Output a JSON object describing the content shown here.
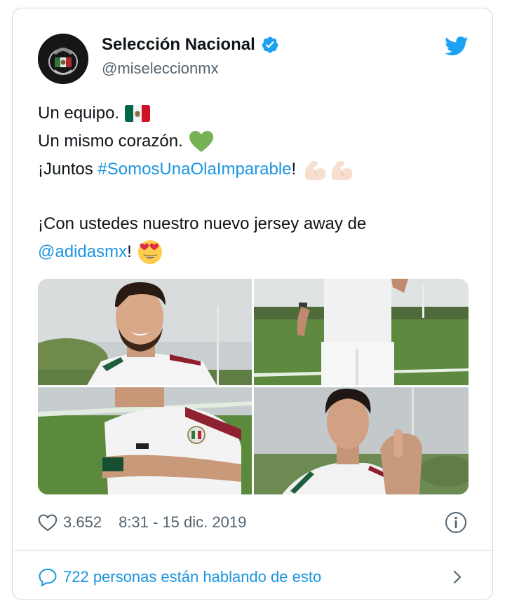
{
  "account": {
    "name": "Selección Nacional",
    "handle": "@miseleccionmx",
    "verified": true
  },
  "tweet": {
    "line1": "Un equipo.",
    "line2": "Un mismo corazón.",
    "line3_prefix": "¡Juntos ",
    "line3_hashtag": "#SomosUnaOlaImparable",
    "line3_suffix": "!",
    "line4": "¡Con ustedes nuestro nuevo jersey away de",
    "line5_mention": "@adidasmx",
    "line5_suffix": "!",
    "emojis": [
      "mexico-flag",
      "green-heart",
      "flexed-biceps",
      "flexed-biceps",
      "heart-eyes-face"
    ]
  },
  "media": {
    "photos": [
      "player-smiling-portrait",
      "player-shorts-on-field",
      "player-arms-crossed-crest",
      "player-pointing"
    ]
  },
  "footer": {
    "likes": "3.652",
    "timestamp": "8:31 - 15 dic. 2019",
    "conversation": "722 personas están hablando de esto"
  },
  "colors": {
    "link": "#1b95e0",
    "secondary_text": "#536471",
    "border": "#cfd9de",
    "twitter_blue": "#1da1f2"
  }
}
